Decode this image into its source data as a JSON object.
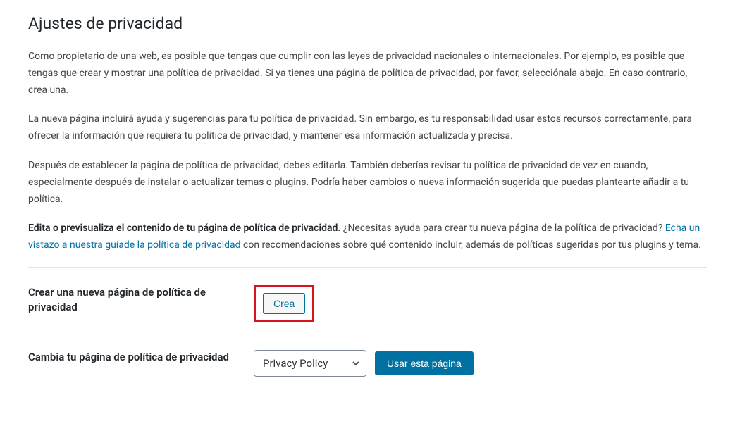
{
  "title": "Ajustes de privacidad",
  "paragraphs": {
    "p1": "Como propietario de una web, es posible que tengas que cumplir con las leyes de privacidad nacionales o internacionales. Por ejemplo, es posible que tengas que crear y mostrar una política de privacidad. Si ya tienes una página de política de privacidad, por favor, selecciónala abajo. En caso contrario, crea una.",
    "p2": "La nueva página incluirá ayuda y sugerencias para tu política de privacidad. Sin embargo, es tu responsabilidad usar estos recursos correctamente, para ofrecer la información que requiera tu política de privacidad, y mantener esa información actualizada y precisa.",
    "p3": "Después de establecer la página de política de privacidad, debes editarla. También deberías revisar tu política de privacidad de vez en cuando, especialmente después de instalar o actualizar temas o plugins. Podría haber cambios o nueva información sugerida que puedas plantearte añadir a tu política."
  },
  "links": {
    "edit": "Edita",
    "or": " o ",
    "preview": "previsualiza",
    "bold_suffix": " el contenido de tu página de política de privacidad.",
    "help_prefix": " ¿Necesitas ayuda para crear tu nueva página de la política de privacidad? ",
    "guide": "Echa un vistazo a nuestra guíade la política de privacidad",
    "help_suffix": " con recomendaciones sobre qué contenido incluir, además de políticas sugeridas por tus plugins y tema."
  },
  "form": {
    "create_label": "Crear una nueva página de política de privacidad",
    "create_button": "Crea",
    "change_label": "Cambia tu página de política de privacidad",
    "select_value": "Privacy Policy",
    "use_button": "Usar esta página"
  }
}
